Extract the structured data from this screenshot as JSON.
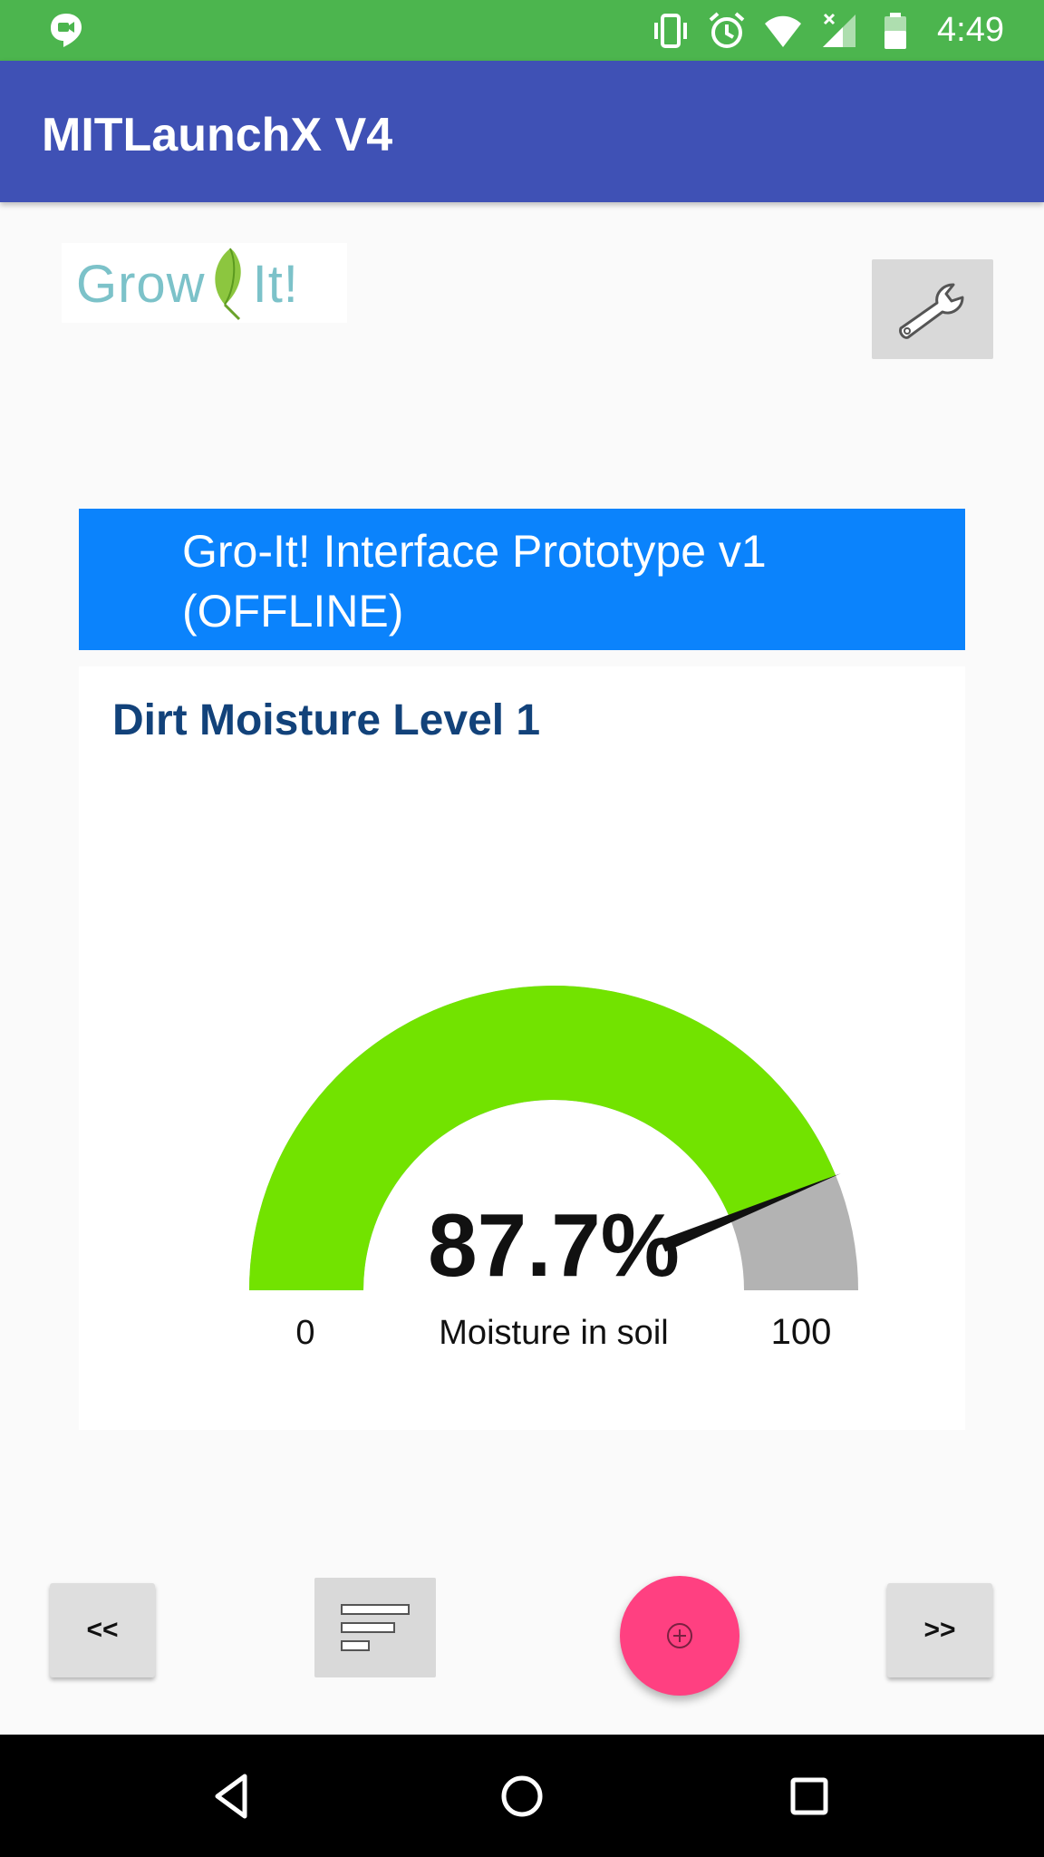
{
  "status_bar": {
    "time": "4:49",
    "left_icon": "hangouts-icon",
    "right_icons": [
      "vibrate-icon",
      "alarm-icon",
      "wifi-icon",
      "signal-icon",
      "battery-icon"
    ]
  },
  "app_bar": {
    "title": "MITLaunchX V4"
  },
  "logo": {
    "text_left": "Grow",
    "text_right": "It!"
  },
  "banner": {
    "text": "Gro-It! Interface Prototype v1 (OFFLINE)"
  },
  "card": {
    "title": "Dirt Moisture Level 1"
  },
  "chart_data": {
    "type": "gauge",
    "value": 87.7,
    "value_label": "87.7%",
    "label": "Moisture in soil",
    "min": 0,
    "max": 100,
    "min_label": "0",
    "max_label": "100",
    "fill_color": "#72e300",
    "track_color": "#b3b3b3"
  },
  "bottom_controls": {
    "prev_label": "<<",
    "next_label": ">>",
    "list_icon": "list-icon",
    "fab_icon": "add-circle-icon",
    "fab_color": "#ff4081"
  },
  "system_nav": [
    "back-icon",
    "home-icon",
    "recents-icon"
  ]
}
